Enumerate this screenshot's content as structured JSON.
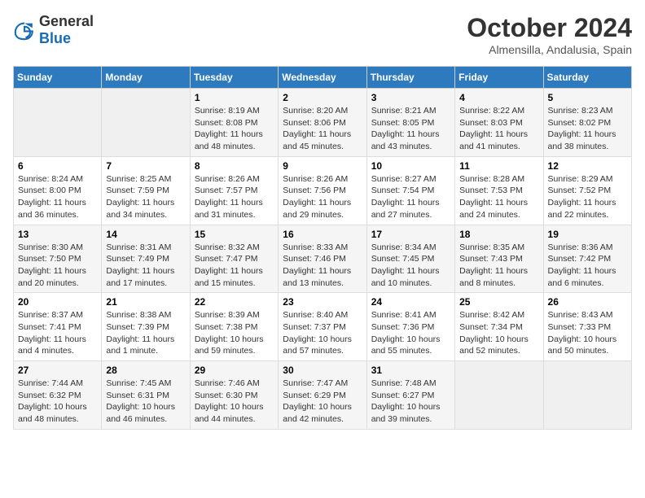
{
  "logo": {
    "text_general": "General",
    "text_blue": "Blue"
  },
  "header": {
    "month": "October 2024",
    "location": "Almensilla, Andalusia, Spain"
  },
  "weekdays": [
    "Sunday",
    "Monday",
    "Tuesday",
    "Wednesday",
    "Thursday",
    "Friday",
    "Saturday"
  ],
  "weeks": [
    [
      {
        "day": "",
        "sunrise": "",
        "sunset": "",
        "daylight": ""
      },
      {
        "day": "",
        "sunrise": "",
        "sunset": "",
        "daylight": ""
      },
      {
        "day": "1",
        "sunrise": "Sunrise: 8:19 AM",
        "sunset": "Sunset: 8:08 PM",
        "daylight": "Daylight: 11 hours and 48 minutes."
      },
      {
        "day": "2",
        "sunrise": "Sunrise: 8:20 AM",
        "sunset": "Sunset: 8:06 PM",
        "daylight": "Daylight: 11 hours and 45 minutes."
      },
      {
        "day": "3",
        "sunrise": "Sunrise: 8:21 AM",
        "sunset": "Sunset: 8:05 PM",
        "daylight": "Daylight: 11 hours and 43 minutes."
      },
      {
        "day": "4",
        "sunrise": "Sunrise: 8:22 AM",
        "sunset": "Sunset: 8:03 PM",
        "daylight": "Daylight: 11 hours and 41 minutes."
      },
      {
        "day": "5",
        "sunrise": "Sunrise: 8:23 AM",
        "sunset": "Sunset: 8:02 PM",
        "daylight": "Daylight: 11 hours and 38 minutes."
      }
    ],
    [
      {
        "day": "6",
        "sunrise": "Sunrise: 8:24 AM",
        "sunset": "Sunset: 8:00 PM",
        "daylight": "Daylight: 11 hours and 36 minutes."
      },
      {
        "day": "7",
        "sunrise": "Sunrise: 8:25 AM",
        "sunset": "Sunset: 7:59 PM",
        "daylight": "Daylight: 11 hours and 34 minutes."
      },
      {
        "day": "8",
        "sunrise": "Sunrise: 8:26 AM",
        "sunset": "Sunset: 7:57 PM",
        "daylight": "Daylight: 11 hours and 31 minutes."
      },
      {
        "day": "9",
        "sunrise": "Sunrise: 8:26 AM",
        "sunset": "Sunset: 7:56 PM",
        "daylight": "Daylight: 11 hours and 29 minutes."
      },
      {
        "day": "10",
        "sunrise": "Sunrise: 8:27 AM",
        "sunset": "Sunset: 7:54 PM",
        "daylight": "Daylight: 11 hours and 27 minutes."
      },
      {
        "day": "11",
        "sunrise": "Sunrise: 8:28 AM",
        "sunset": "Sunset: 7:53 PM",
        "daylight": "Daylight: 11 hours and 24 minutes."
      },
      {
        "day": "12",
        "sunrise": "Sunrise: 8:29 AM",
        "sunset": "Sunset: 7:52 PM",
        "daylight": "Daylight: 11 hours and 22 minutes."
      }
    ],
    [
      {
        "day": "13",
        "sunrise": "Sunrise: 8:30 AM",
        "sunset": "Sunset: 7:50 PM",
        "daylight": "Daylight: 11 hours and 20 minutes."
      },
      {
        "day": "14",
        "sunrise": "Sunrise: 8:31 AM",
        "sunset": "Sunset: 7:49 PM",
        "daylight": "Daylight: 11 hours and 17 minutes."
      },
      {
        "day": "15",
        "sunrise": "Sunrise: 8:32 AM",
        "sunset": "Sunset: 7:47 PM",
        "daylight": "Daylight: 11 hours and 15 minutes."
      },
      {
        "day": "16",
        "sunrise": "Sunrise: 8:33 AM",
        "sunset": "Sunset: 7:46 PM",
        "daylight": "Daylight: 11 hours and 13 minutes."
      },
      {
        "day": "17",
        "sunrise": "Sunrise: 8:34 AM",
        "sunset": "Sunset: 7:45 PM",
        "daylight": "Daylight: 11 hours and 10 minutes."
      },
      {
        "day": "18",
        "sunrise": "Sunrise: 8:35 AM",
        "sunset": "Sunset: 7:43 PM",
        "daylight": "Daylight: 11 hours and 8 minutes."
      },
      {
        "day": "19",
        "sunrise": "Sunrise: 8:36 AM",
        "sunset": "Sunset: 7:42 PM",
        "daylight": "Daylight: 11 hours and 6 minutes."
      }
    ],
    [
      {
        "day": "20",
        "sunrise": "Sunrise: 8:37 AM",
        "sunset": "Sunset: 7:41 PM",
        "daylight": "Daylight: 11 hours and 4 minutes."
      },
      {
        "day": "21",
        "sunrise": "Sunrise: 8:38 AM",
        "sunset": "Sunset: 7:39 PM",
        "daylight": "Daylight: 11 hours and 1 minute."
      },
      {
        "day": "22",
        "sunrise": "Sunrise: 8:39 AM",
        "sunset": "Sunset: 7:38 PM",
        "daylight": "Daylight: 10 hours and 59 minutes."
      },
      {
        "day": "23",
        "sunrise": "Sunrise: 8:40 AM",
        "sunset": "Sunset: 7:37 PM",
        "daylight": "Daylight: 10 hours and 57 minutes."
      },
      {
        "day": "24",
        "sunrise": "Sunrise: 8:41 AM",
        "sunset": "Sunset: 7:36 PM",
        "daylight": "Daylight: 10 hours and 55 minutes."
      },
      {
        "day": "25",
        "sunrise": "Sunrise: 8:42 AM",
        "sunset": "Sunset: 7:34 PM",
        "daylight": "Daylight: 10 hours and 52 minutes."
      },
      {
        "day": "26",
        "sunrise": "Sunrise: 8:43 AM",
        "sunset": "Sunset: 7:33 PM",
        "daylight": "Daylight: 10 hours and 50 minutes."
      }
    ],
    [
      {
        "day": "27",
        "sunrise": "Sunrise: 7:44 AM",
        "sunset": "Sunset: 6:32 PM",
        "daylight": "Daylight: 10 hours and 48 minutes."
      },
      {
        "day": "28",
        "sunrise": "Sunrise: 7:45 AM",
        "sunset": "Sunset: 6:31 PM",
        "daylight": "Daylight: 10 hours and 46 minutes."
      },
      {
        "day": "29",
        "sunrise": "Sunrise: 7:46 AM",
        "sunset": "Sunset: 6:30 PM",
        "daylight": "Daylight: 10 hours and 44 minutes."
      },
      {
        "day": "30",
        "sunrise": "Sunrise: 7:47 AM",
        "sunset": "Sunset: 6:29 PM",
        "daylight": "Daylight: 10 hours and 42 minutes."
      },
      {
        "day": "31",
        "sunrise": "Sunrise: 7:48 AM",
        "sunset": "Sunset: 6:27 PM",
        "daylight": "Daylight: 10 hours and 39 minutes."
      },
      {
        "day": "",
        "sunrise": "",
        "sunset": "",
        "daylight": ""
      },
      {
        "day": "",
        "sunrise": "",
        "sunset": "",
        "daylight": ""
      }
    ]
  ]
}
